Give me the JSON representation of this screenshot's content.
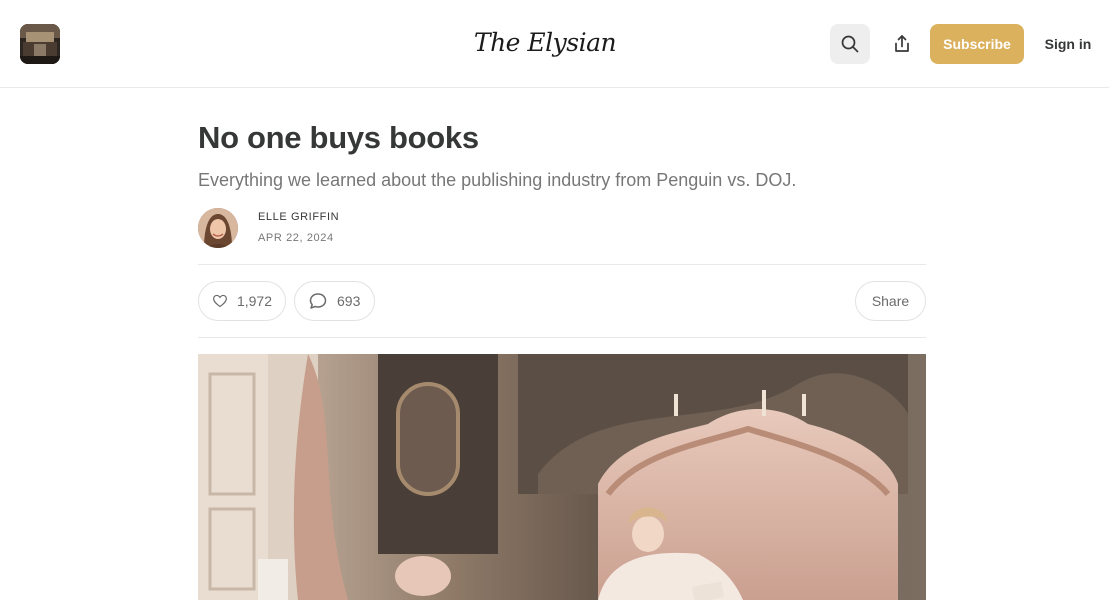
{
  "header": {
    "publication_logo_icon": "publication-thumbnail",
    "wordmark": "The Elysian",
    "search_icon": "search-icon",
    "share_icon": "share-upload-icon",
    "subscribe_label": "Subscribe",
    "signin_label": "Sign in"
  },
  "article": {
    "title": "No one buys books",
    "subtitle": "Everything we learned about the publishing industry from Penguin vs. DOJ.",
    "author": "ELLE GRIFFIN",
    "date": "APR 22, 2024"
  },
  "actions": {
    "likes": "1,972",
    "comments": "693",
    "share_label": "Share"
  },
  "colors": {
    "accent": "#dbb15e",
    "text": "#363737",
    "muted": "#777777"
  }
}
